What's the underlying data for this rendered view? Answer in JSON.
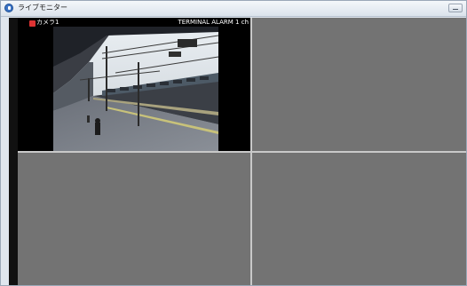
{
  "window": {
    "title": "ライブモニター"
  },
  "cameras": [
    {
      "name": "カメラ1",
      "alarm_text": "TERMINAL  ALARM 1 ch"
    }
  ],
  "colors": {
    "empty_pane": "#737373",
    "video_bg": "#000000",
    "divider": "#c9c9c9"
  },
  "icons": {
    "app": "live-monitor-icon",
    "camera": "camera-icon",
    "minimize": "minimize-icon"
  }
}
